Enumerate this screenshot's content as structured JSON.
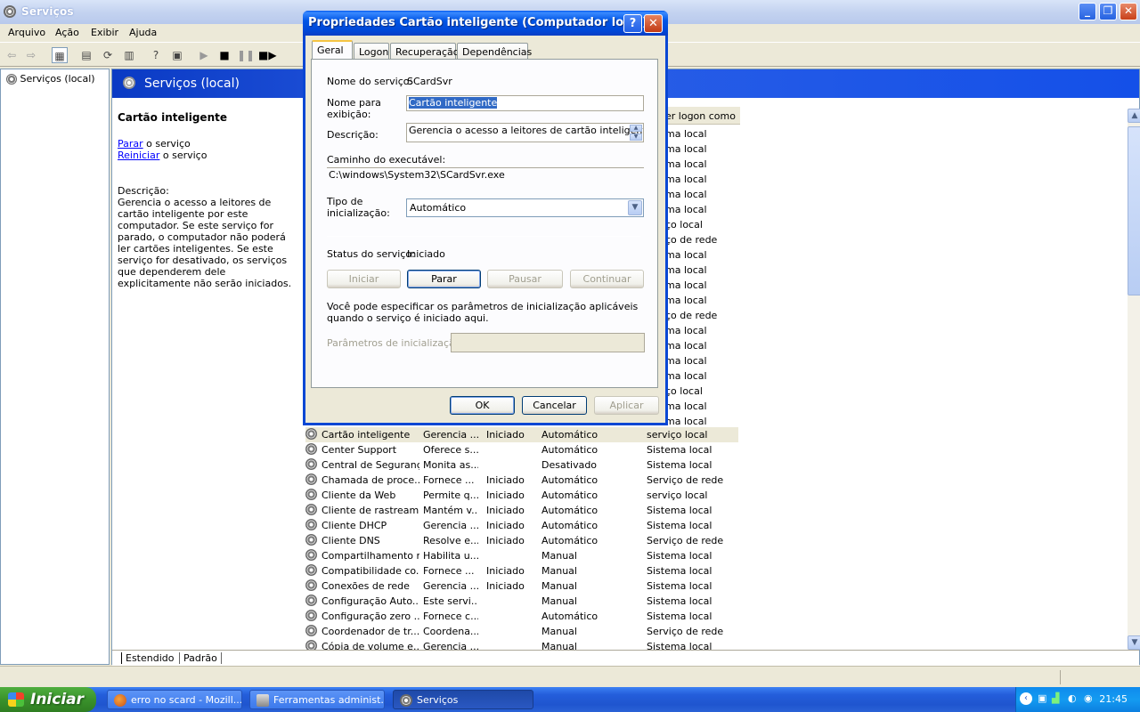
{
  "window": {
    "title": "Serviços"
  },
  "menu": [
    "Arquivo",
    "Ação",
    "Exibir",
    "Ajuda"
  ],
  "tree": {
    "root": "Serviços (local)"
  },
  "pane": {
    "header": "Serviços (local)",
    "selected_name": "Cartão inteligente",
    "stop_link": "Parar",
    "stop_suffix": " o serviço",
    "restart_link": "Reiniciar",
    "restart_suffix": " o serviço",
    "desc_label": "Descrição:",
    "desc_text": "Gerencia o acesso a leitores de cartão inteligente por este computador. Se este serviço for parado, o computador não poderá ler cartões inteligentes. Se este serviço for desativado, os serviços que dependerem dele explicitamente não serão iniciados."
  },
  "list": {
    "col_logon": "er logon como",
    "hidden_logons": [
      "ma local",
      "ma local",
      "ma local",
      "ma local",
      "ma local",
      "ma local",
      "ço local",
      "ço de rede",
      "ma local",
      "ma local",
      "ma local",
      "ma local",
      "ço de rede",
      "ma local",
      "ma local",
      "ma local",
      "ma local",
      "ço local",
      "ma local",
      "ma local"
    ],
    "rows": [
      {
        "name": "Cartão inteligente",
        "desc": "Gerencia ...",
        "status": "Iniciado",
        "startup": "Automático",
        "logon": "serviço local",
        "selected": true
      },
      {
        "name": "Center Support",
        "desc": "Oferece s...",
        "status": "",
        "startup": "Automático",
        "logon": "Sistema local"
      },
      {
        "name": "Central de Segurança",
        "desc": "Monita as...",
        "status": "",
        "startup": "Desativado",
        "logon": "Sistema local"
      },
      {
        "name": "Chamada de proce...",
        "desc": "Fornece ...",
        "status": "Iniciado",
        "startup": "Automático",
        "logon": "Serviço de rede"
      },
      {
        "name": "Cliente da Web",
        "desc": "Permite q...",
        "status": "Iniciado",
        "startup": "Automático",
        "logon": "serviço local"
      },
      {
        "name": "Cliente de rastream...",
        "desc": "Mantém v...",
        "status": "Iniciado",
        "startup": "Automático",
        "logon": "Sistema local"
      },
      {
        "name": "Cliente DHCP",
        "desc": "Gerencia ...",
        "status": "Iniciado",
        "startup": "Automático",
        "logon": "Sistema local"
      },
      {
        "name": "Cliente DNS",
        "desc": "Resolve e...",
        "status": "Iniciado",
        "startup": "Automático",
        "logon": "Serviço de rede"
      },
      {
        "name": "Compartilhamento r...",
        "desc": "Habilita u...",
        "status": "",
        "startup": "Manual",
        "logon": "Sistema local"
      },
      {
        "name": "Compatibilidade co...",
        "desc": "Fornece ...",
        "status": "Iniciado",
        "startup": "Manual",
        "logon": "Sistema local"
      },
      {
        "name": "Conexões de rede",
        "desc": "Gerencia ...",
        "status": "Iniciado",
        "startup": "Manual",
        "logon": "Sistema local"
      },
      {
        "name": "Configuração Auto...",
        "desc": "Este servi...",
        "status": "",
        "startup": "Manual",
        "logon": "Sistema local"
      },
      {
        "name": "Configuração zero ...",
        "desc": "Fornece c...",
        "status": "",
        "startup": "Automático",
        "logon": "Sistema local"
      },
      {
        "name": "Coordenador de tr...",
        "desc": "Coordena...",
        "status": "",
        "startup": "Manual",
        "logon": "Serviço de rede"
      },
      {
        "name": "Cópia de volume e...",
        "desc": "Gerencia ...",
        "status": "",
        "startup": "Manual",
        "logon": "Sistema local"
      }
    ]
  },
  "bottom_tabs": [
    "Estendido",
    "Padrão"
  ],
  "taskbar": {
    "start": "Iniciar",
    "tasks": [
      "erro no scard - Mozill...",
      "Ferramentas administ...",
      "Serviços"
    ],
    "clock": "21:45"
  },
  "dialog": {
    "title": "Propriedades Cartão inteligente (Computador local)",
    "tabs": [
      "Geral",
      "Logon",
      "Recuperação",
      "Dependências"
    ],
    "service_name_label": "Nome do serviço:",
    "service_name": "SCardSvr",
    "display_name_label_1": "Nome para",
    "display_name_label_2": "exibição:",
    "display_name": "Cartão inteligente",
    "description_label": "Descrição:",
    "description": "Gerencia o acesso a leitores de cartão inteligente",
    "exe_path_label": "Caminho do executável:",
    "exe_path": "C:\\windows\\System32\\SCardSvr.exe",
    "startup_label_1": "Tipo de",
    "startup_label_2": "inicialização:",
    "startup_value": "Automático",
    "status_label": "Status do serviço:",
    "status_value": "Iniciado",
    "btn_start": "Iniciar",
    "btn_stop": "Parar",
    "btn_pause": "Pausar",
    "btn_continue": "Continuar",
    "params_hint": "Você pode especificar os parâmetros de inicialização aplicáveis quando o serviço é iniciado aqui.",
    "params_label": "Parâmetros de inicialização:",
    "params_value": "",
    "ok": "OK",
    "cancel": "Cancelar",
    "apply": "Aplicar"
  }
}
